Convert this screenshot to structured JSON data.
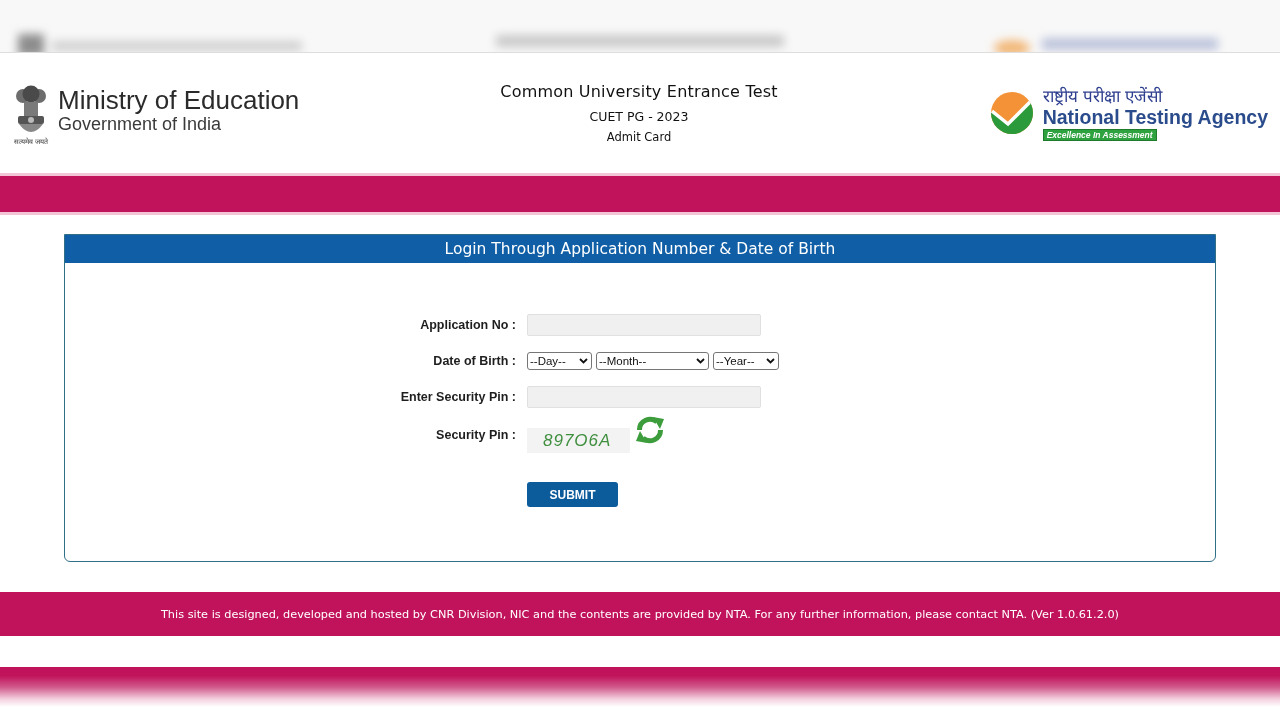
{
  "header": {
    "ministry": {
      "motto": "सत्यमेव जयते",
      "title": "Ministry of Education",
      "subtitle": "Government of India"
    },
    "exam": {
      "title": "Common University Entrance Test",
      "edition": "CUET PG - 2023",
      "document": "Admit Card"
    },
    "agency": {
      "hindi_name": "राष्ट्रीय परीक्षा एजेंसी",
      "name": "National Testing Agency",
      "tagline": "Excellence In Assessment"
    }
  },
  "login_panel": {
    "title": "Login Through Application Number & Date of Birth",
    "fields": [
      {
        "kind": "text",
        "label": "Application No :"
      },
      {
        "kind": "date",
        "label": "Date of Birth :",
        "selects": [
          "--Day--",
          "--Month--",
          "--Year--"
        ]
      },
      {
        "kind": "text",
        "label": "Enter Security Pin :"
      },
      {
        "kind": "captcha",
        "label": "Security Pin :",
        "code": "897O6A"
      }
    ],
    "submit": "SUBMIT"
  },
  "footer": {
    "text": "This site is designed, developed and hosted by CNR Division, NIC and the contents are provided by NTA. For any further information, please contact NTA. (Ver 1.0.61.2.0)"
  }
}
